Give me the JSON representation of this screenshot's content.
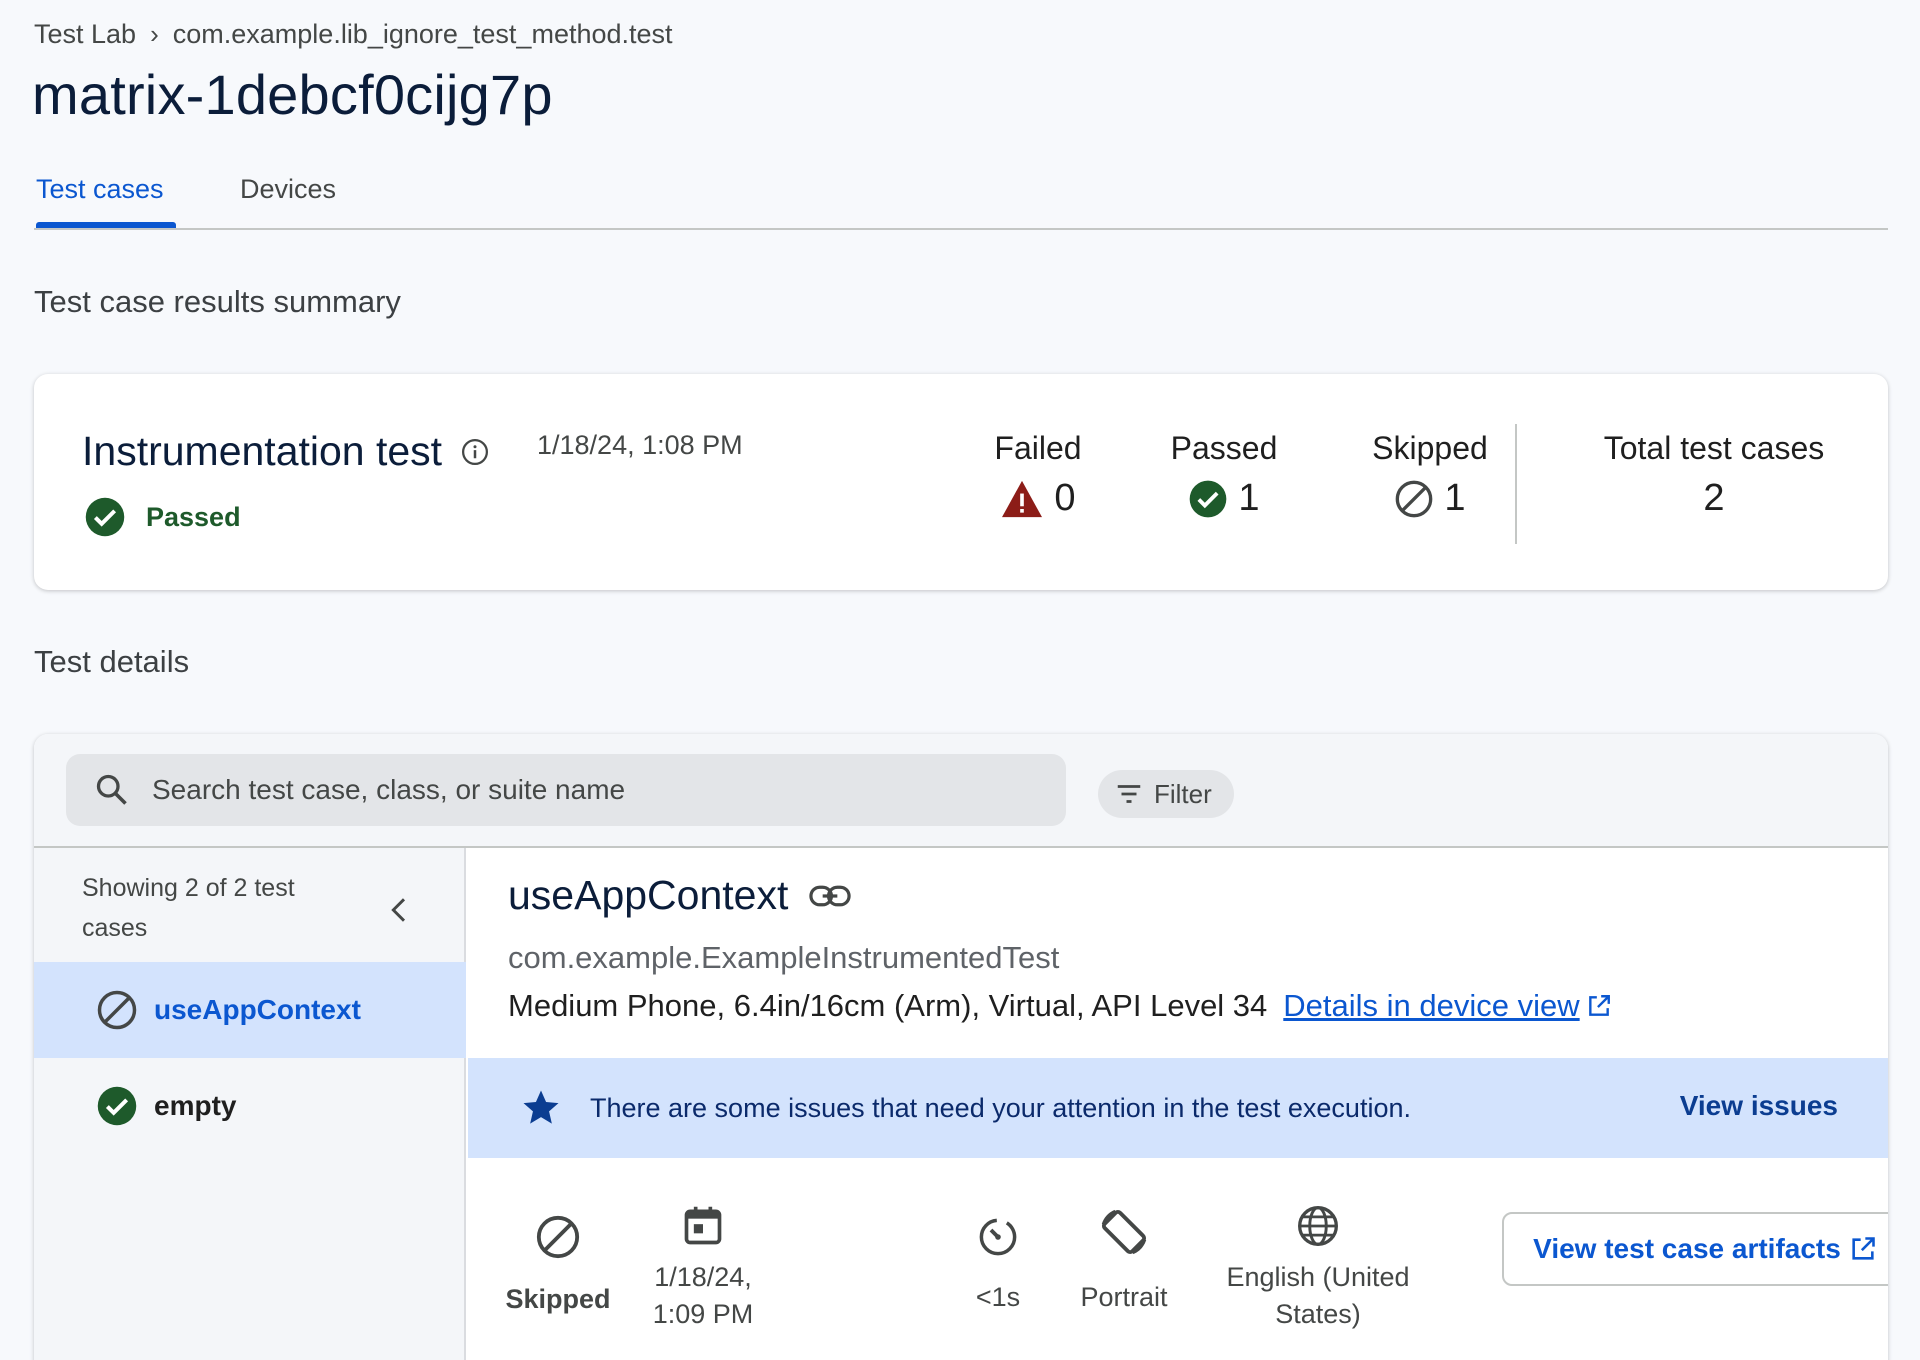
{
  "breadcrumb": {
    "root": "Test Lab",
    "current": "com.example.lib_ignore_test_method.test"
  },
  "page": {
    "title": "matrix-1debcf0cijg7p"
  },
  "tabs": [
    {
      "label": "Test cases"
    },
    {
      "label": "Devices"
    }
  ],
  "summary": {
    "heading": "Test case results summary",
    "test_type": "Instrumentation test",
    "timestamp": "1/18/24, 1:08 PM",
    "status": "Passed",
    "stats": {
      "failed": {
        "label": "Failed",
        "value": "0"
      },
      "passed": {
        "label": "Passed",
        "value": "1"
      },
      "skipped": {
        "label": "Skipped",
        "value": "1"
      },
      "total": {
        "label": "Total test cases",
        "value": "2"
      }
    }
  },
  "details": {
    "heading": "Test details",
    "search_placeholder": "Search test case, class, or suite name",
    "filter_label": "Filter",
    "showing": "Showing 2 of 2 test cases",
    "test_cases": [
      {
        "name": "useAppContext",
        "status": "skipped"
      },
      {
        "name": "empty",
        "status": "passed"
      }
    ],
    "selected": {
      "name": "useAppContext",
      "class": "com.example.ExampleInstrumentedTest",
      "device": "Medium Phone, 6.4in/16cm (Arm), Virtual, API Level 34",
      "device_link": "Details in device view",
      "banner_text": "There are some issues that need your attention in the test execution.",
      "banner_action": "View issues",
      "meta": {
        "status": "Skipped",
        "date_line1": "1/18/24,",
        "date_line2": "1:09 PM",
        "duration": "<1s",
        "orientation": "Portrait",
        "locale_line1": "English (United",
        "locale_line2": "States)"
      },
      "artifacts_label": "View test case artifacts"
    }
  },
  "colors": {
    "accent": "#0b57d0",
    "passed": "#1e5a2b",
    "failed": "#8c1d18",
    "banner": "#d3e3fd"
  }
}
